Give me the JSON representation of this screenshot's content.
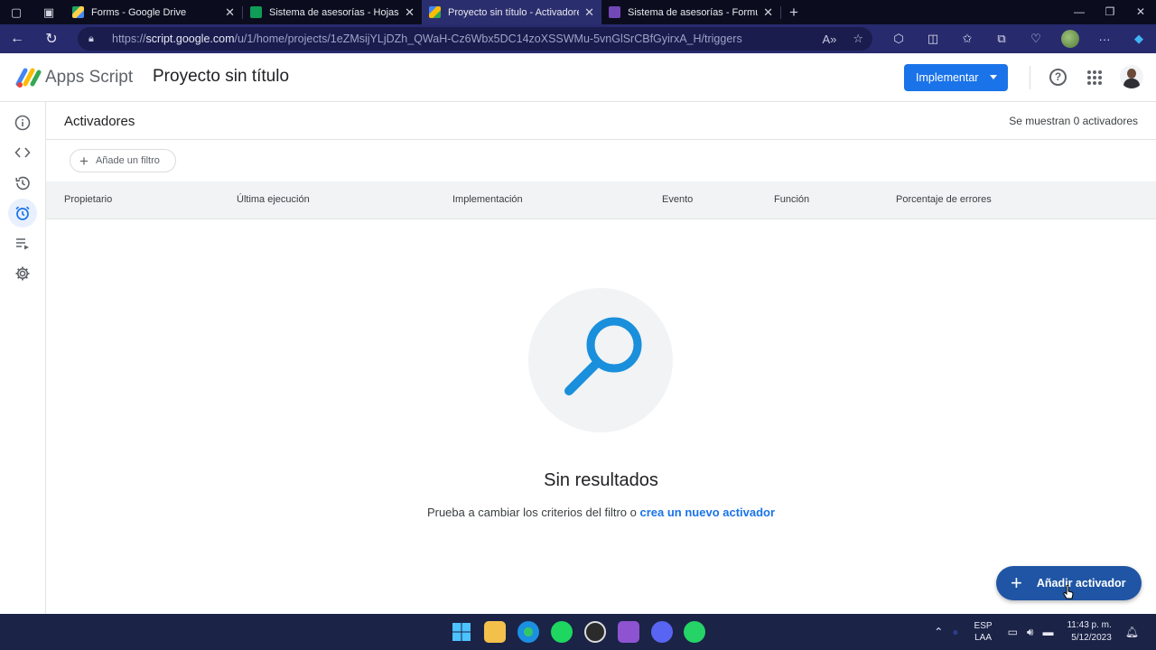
{
  "browser": {
    "tabs": [
      {
        "label": "Forms - Google Drive",
        "active": false
      },
      {
        "label": "Sistema de asesorías - Hojas de c",
        "active": false
      },
      {
        "label": "Proyecto sin título - Activadores",
        "active": true
      },
      {
        "label": "Sistema de asesorías - Formulari",
        "active": false
      }
    ],
    "url_prefix": "https://",
    "url_host": "script.google.com",
    "url_path": "/u/1/home/projects/1eZMsijYLjDZh_QWaH-Cz6Wbx5DC14zoXSSWMu-5vnGlSrCBfGyirxA_H/triggers"
  },
  "app": {
    "brand": "Apps Script",
    "project_title": "Proyecto sin título",
    "deploy_label": "Implementar"
  },
  "triggers": {
    "heading": "Activadores",
    "count_text": "Se muestran 0 activadores",
    "filter_label": "Añade un filtro",
    "columns": [
      "Propietario",
      "Última ejecución",
      "Implementación",
      "Evento",
      "Función",
      "Porcentaje de errores"
    ],
    "empty_title": "Sin resultados",
    "empty_hint": "Prueba a cambiar los criterios del filtro o",
    "empty_link": "crea un nuevo activador",
    "fab_label": "Añadir activador"
  },
  "taskbar": {
    "lang_1": "ESP",
    "lang_2": "LAA",
    "time": "11:43 p. m.",
    "date": "5/12/2023"
  },
  "colors": {
    "accent": "#1a73e8",
    "fab": "#1f55a4",
    "browser_chrome": "#282a6e"
  }
}
